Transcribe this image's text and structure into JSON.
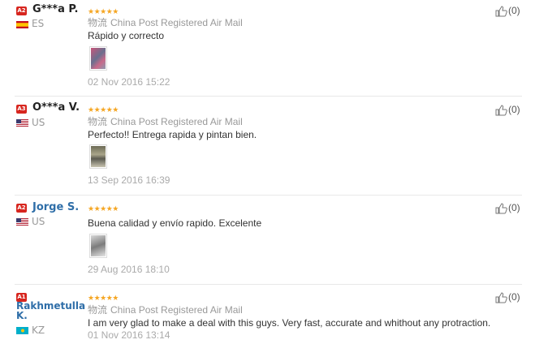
{
  "reviews": [
    {
      "level": "A2",
      "name": "G***a P.",
      "country": "ES",
      "stars": "★★★★★",
      "shipping_cn": "物流",
      "shipping": "China Post Registered Air Mail",
      "feedback": "Rápido y correcto",
      "date": "02 Nov 2016 15:22",
      "helpful": "(0)"
    },
    {
      "level": "A3",
      "name": "O***a V.",
      "country": "US",
      "stars": "★★★★★",
      "shipping_cn": "物流",
      "shipping": "China Post Registered Air Mail",
      "feedback": "Perfecto!! Entrega rapida y pintan bien.",
      "date": "13 Sep 2016 16:39",
      "helpful": "(0)"
    },
    {
      "level": "A2",
      "name": "Jorge S.",
      "country": "US",
      "stars": "★★★★★",
      "feedback": "Buena calidad y envío rapido. Excelente",
      "date": "29 Aug 2016 18:10",
      "helpful": "(0)"
    },
    {
      "level": "A1",
      "name": "Rakhmetulla K.",
      "country": "KZ",
      "stars": "★★★★★",
      "shipping_cn": "物流",
      "shipping": "China Post Registered Air Mail",
      "feedback": "I am very glad to make a deal with this guys. Very fast, accurate and whithout any protraction.",
      "date": "01 Nov 2016 13:14",
      "helpful": "(0)"
    }
  ],
  "colors": {
    "badge": "#d7261f",
    "star": "#f5a623",
    "link_name": "#2f6ea8"
  },
  "icons": {
    "helpful": "thumbs-up-icon"
  }
}
